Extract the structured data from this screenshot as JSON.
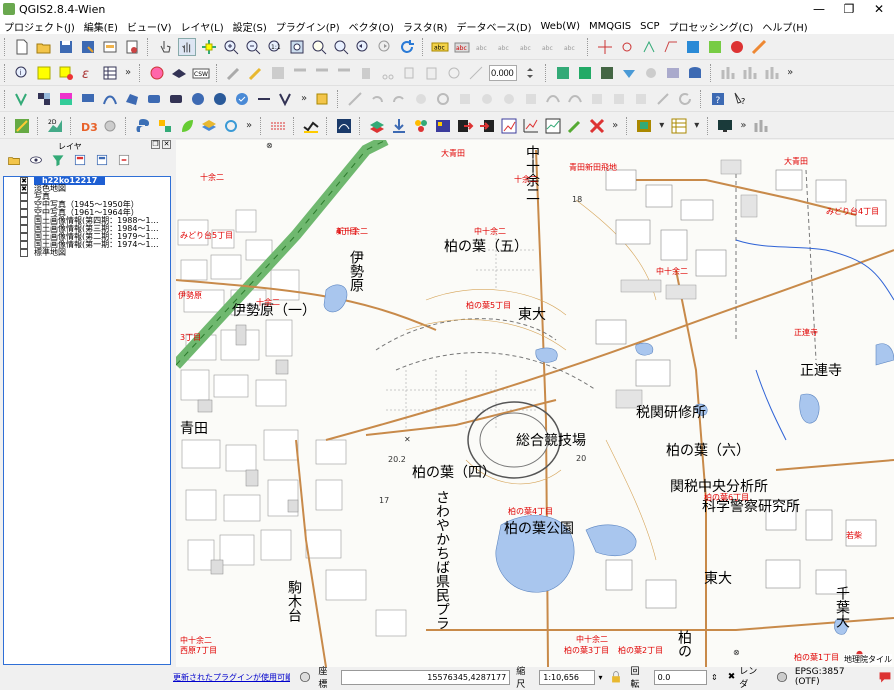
{
  "window": {
    "title": "QGIS2.8.4-Wien",
    "minimize": "—",
    "maximize": "❐",
    "close": "✕"
  },
  "menu": [
    "プロジェクト(J)",
    "編集(E)",
    "ビュー(V)",
    "レイヤ(L)",
    "設定(S)",
    "プラグイン(P)",
    "ベクタ(O)",
    "ラスタ(R)",
    "データベース(D)",
    "Web(W)",
    "MMQGIS",
    "SCP",
    "プロセッシング(C)",
    "ヘルプ(H)"
  ],
  "toolbar": {
    "overflow": "»",
    "scale_spin": "0.000"
  },
  "layers_panel": {
    "title": "レイヤ",
    "layers": [
      {
        "name": "h22ko12217",
        "checked": true,
        "selected": true
      },
      {
        "name": "淡色地図",
        "checked": true,
        "selected": false
      },
      {
        "name": "写真",
        "checked": false,
        "selected": false
      },
      {
        "name": "空中写真（1945～1950年）",
        "checked": false,
        "selected": false
      },
      {
        "name": "空中写真（1961～1964年）",
        "checked": false,
        "selected": false
      },
      {
        "name": "国土画像情報(第四期：1988～1…",
        "checked": false,
        "selected": false
      },
      {
        "name": "国土画像情報(第三期：1984～1…",
        "checked": false,
        "selected": false
      },
      {
        "name": "国土画像情報(第二期：1979～1…",
        "checked": false,
        "selected": false
      },
      {
        "name": "国土画像情報(第一期：1974～1…",
        "checked": false,
        "selected": false
      },
      {
        "name": "標準地図",
        "checked": false,
        "selected": false
      }
    ]
  },
  "map": {
    "labels_big": [
      "柏の葉（五）",
      "東大",
      "伊勢原（一）",
      "正連寺",
      "税関研修所",
      "柏の葉（六）",
      "総合競技場",
      "柏の葉（四）",
      "関税中央分析所",
      "科学警察研究所",
      "柏の葉公園",
      "東大",
      "青田"
    ],
    "labels_vertical": [
      "中十余二",
      "伊勢原",
      "さわやかちば県民プラ",
      "駒木台",
      "千葉大",
      "柏の"
    ],
    "labels_red": [
      "大青田",
      "青田新田飛地",
      "十余二",
      "中十余二",
      "新十余二",
      "大青田",
      "十余二",
      "みどり台4丁目",
      "みどり台5丁目",
      "伊勢原",
      "十余二",
      "柏の葉5丁目",
      "中十余二",
      "正連寺",
      "3丁目",
      "柏の葉4丁目",
      "柏の葉6丁目",
      "若柴",
      "中十余二",
      "柏の葉3丁目",
      "柏の葉2丁目",
      "柏の葉1丁目",
      "中十余二",
      "西原7丁目",
      "4丁目",
      "十余二"
    ],
    "labels_small": [
      "18",
      "20.2",
      "20",
      "17"
    ],
    "attribution": "地理院タイル"
  },
  "statusbar": {
    "plugin_link": "更新されたプラグインが使用可能です",
    "coord_label": "座標",
    "coord_value": "15576345,4287177",
    "scale_label": "縮尺",
    "scale_value": "1:10,656",
    "rotation_label": "回転",
    "rotation_value": "0.0",
    "render_label": "レンダ",
    "crs": "EPSG:3857 (OTF)"
  },
  "colors": {
    "selection": "#1e5fd3",
    "accent_red": "#e00000",
    "water": "#a9c6ee",
    "link": "#0000cc"
  }
}
